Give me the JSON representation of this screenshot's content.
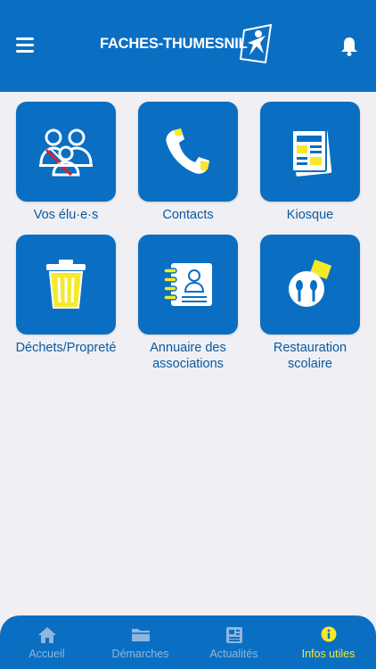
{
  "header": {
    "logo_text": "FACHES-THUMESNIL",
    "menu_icon": "hamburger-icon",
    "notification_icon": "bell-icon"
  },
  "tiles": [
    {
      "label": "Vos élu·e·s",
      "icon": "elected-officials-icon"
    },
    {
      "label": "Contacts",
      "icon": "phone-icon"
    },
    {
      "label": "Kiosque",
      "icon": "newspaper-icon"
    },
    {
      "label": "Déchets/Propreté",
      "icon": "trash-bin-icon"
    },
    {
      "label": "Annuaire des\nassociations",
      "icon": "directory-icon"
    },
    {
      "label": "Restauration\nscolaire",
      "icon": "cutlery-plate-icon"
    }
  ],
  "tabbar": {
    "tabs": [
      {
        "label": "Accueil",
        "icon": "home-icon"
      },
      {
        "label": "Démarches",
        "icon": "folder-icon"
      },
      {
        "label": "Actualités",
        "icon": "news-icon"
      },
      {
        "label": "Infos utiles",
        "icon": "info-icon",
        "active": true
      }
    ]
  },
  "colors": {
    "primary": "#0a6fc2",
    "accent_yellow": "#f5e92a",
    "background": "#efeff4",
    "label": "#0a5aa0",
    "inactive_tab": "#8fb6df"
  }
}
